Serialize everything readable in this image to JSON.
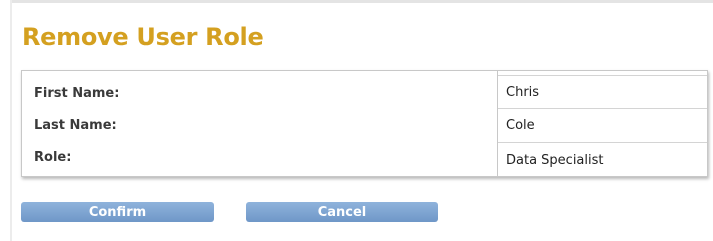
{
  "dialog": {
    "title": "Remove User Role"
  },
  "details": {
    "first_name": {
      "label": "First Name:",
      "value": "Chris"
    },
    "last_name": {
      "label": "Last Name:",
      "value": "Cole"
    },
    "role": {
      "label": "Role:",
      "value": "Data Specialist"
    }
  },
  "actions": {
    "confirm_label": "Confirm",
    "cancel_label": "Cancel"
  },
  "colors": {
    "title": "#d4a020",
    "button": "#7fa5d3"
  }
}
